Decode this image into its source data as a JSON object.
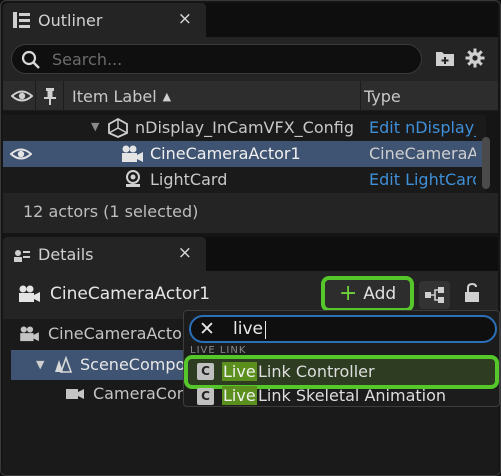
{
  "outliner": {
    "tab_title": "Outliner",
    "tab_close": "×",
    "search_placeholder": "Search...",
    "columns": {
      "label": "Item Label",
      "sort_arrow": "▲",
      "type": "Type"
    },
    "rows": [
      {
        "label": "nDisplay_InCamVFX_Config",
        "type": "Edit nDisplay_",
        "type_is_link": true,
        "selected": false
      },
      {
        "label": "CineCameraActor1",
        "type": "CineCameraAc",
        "type_is_link": false,
        "selected": true
      },
      {
        "label": "LightCard",
        "type": "Edit LightCard",
        "type_is_link": true,
        "selected": false
      }
    ],
    "footer_status": "12 actors (1 selected)"
  },
  "details": {
    "tab_title": "Details",
    "tab_close": "×",
    "actor_name": "CineCameraActor1",
    "add_button_label": "Add",
    "add_button_plus": "+",
    "components": [
      {
        "label": "CineCameraActor",
        "selected": false
      },
      {
        "label": "SceneCompo",
        "selected": true
      },
      {
        "label": "CameraCom",
        "selected": false
      }
    ]
  },
  "add_popup": {
    "search_value": "live",
    "clear_glyph": "✕",
    "category": "LIVE LINK",
    "items": [
      {
        "highlight": "Live",
        "rest": " Link Controller",
        "icon_letter": "C",
        "active": true
      },
      {
        "highlight": "Live",
        "rest": " Link Skeletal Animation",
        "icon_letter": "C",
        "active": false
      }
    ]
  },
  "colors": {
    "selection": "#3f5372",
    "accent_green": "#55c72a",
    "link_blue": "#3f8fd8",
    "focus_blue": "#2b6fb8"
  }
}
